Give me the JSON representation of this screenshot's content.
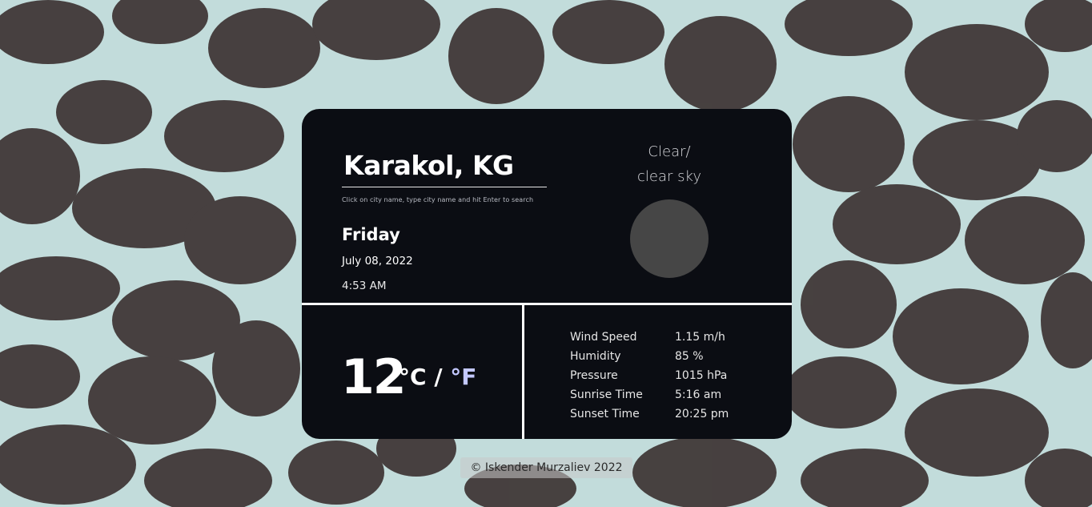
{
  "search": {
    "city_value": "Karakol, KG",
    "hint": "Click on city name, type city name and hit Enter to search"
  },
  "datetime": {
    "day": "Friday",
    "date": "July 08, 2022",
    "time": "4:53 AM"
  },
  "condition": {
    "main": "Clear/",
    "description": "clear sky",
    "icon": "weather-icon-placeholder"
  },
  "temperature": {
    "value": "12",
    "unit_c": "°C",
    "separator": "/",
    "unit_f": "°F"
  },
  "details": [
    {
      "label": "Wind Speed",
      "value": "1.15 m/h"
    },
    {
      "label": "Humidity",
      "value": "85 %"
    },
    {
      "label": "Pressure",
      "value": "1015 hPa"
    },
    {
      "label": "Sunrise Time",
      "value": "5:16 am"
    },
    {
      "label": "Sunset Time",
      "value": "20:25 pm"
    }
  ],
  "footer": {
    "copyright": "© Iskender Murzaliev 2022"
  },
  "colors": {
    "card_bg": "#0b0d13",
    "accent_unit_f": "#c3c8ff",
    "icon_placeholder": "#464646"
  }
}
